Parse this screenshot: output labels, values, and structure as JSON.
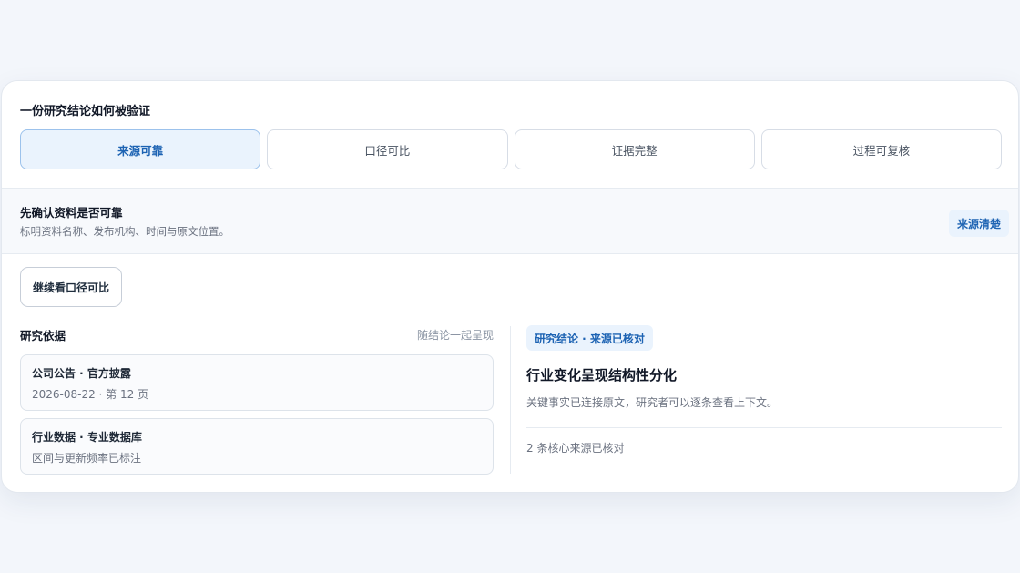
{
  "card": {
    "title": "一份研究结论如何被验证"
  },
  "tabs": [
    {
      "label": "来源可靠",
      "active": true
    },
    {
      "label": "口径可比",
      "active": false
    },
    {
      "label": "证据完整",
      "active": false
    },
    {
      "label": "过程可复核",
      "active": false
    }
  ],
  "step": {
    "title": "先确认资料是否可靠",
    "description": "标明资料名称、发布机构、时间与原文位置。",
    "badge": "来源清楚"
  },
  "next_button": {
    "label": "继续看口径可比"
  },
  "evidence": {
    "title": "研究依据",
    "hint": "随结论一起呈现",
    "items": [
      {
        "name": "公司公告 · 官方披露",
        "meta": "2026-08-22 · 第 12 页"
      },
      {
        "name": "行业数据 · 专业数据库",
        "meta": "区间与更新频率已标注"
      }
    ]
  },
  "conclusion": {
    "badge": "研究结论 · 来源已核对",
    "title": "行业变化呈现结构性分化",
    "description": "关键事实已连接原文，研究者可以逐条查看上下文。",
    "footer": "2 条核心来源已核对"
  },
  "colors": {
    "accent": "#1d63b3",
    "accent_bg": "#eaf3fd",
    "page_bg": "#f3f6fb"
  }
}
